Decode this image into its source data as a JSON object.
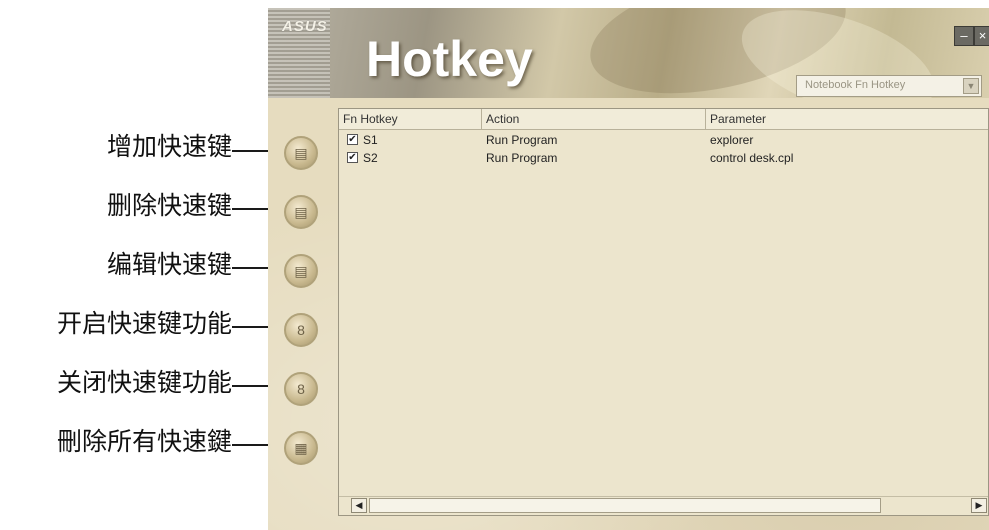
{
  "callouts": [
    {
      "label": "增加快速键"
    },
    {
      "label": "删除快速键"
    },
    {
      "label": "编辑快速键"
    },
    {
      "label": "开启快速键功能"
    },
    {
      "label": "关闭快速键功能"
    },
    {
      "label": "刪除所有快速鍵"
    }
  ],
  "window": {
    "brand": "ASUS",
    "title": "Hotkey",
    "minimize_icon": "minimize-icon",
    "close_icon": "close-icon",
    "dropdown": {
      "selected": "Notebook Fn Hotkey"
    }
  },
  "side_buttons": [
    {
      "icon": "add-icon",
      "glyph": "▤"
    },
    {
      "icon": "delete-icon",
      "glyph": "▤"
    },
    {
      "icon": "edit-icon",
      "glyph": "▤"
    },
    {
      "icon": "enable-icon",
      "glyph": "8"
    },
    {
      "icon": "disable-icon",
      "glyph": "8"
    },
    {
      "icon": "delete-all-icon",
      "glyph": "▦"
    }
  ],
  "table": {
    "columns": [
      "Fn Hotkey",
      "Action",
      "Parameter"
    ],
    "rows": [
      {
        "checked": true,
        "key": "S1",
        "action": "Run Program",
        "parameter": "explorer"
      },
      {
        "checked": true,
        "key": "S2",
        "action": "Run Program",
        "parameter": "control desk.cpl"
      }
    ]
  }
}
